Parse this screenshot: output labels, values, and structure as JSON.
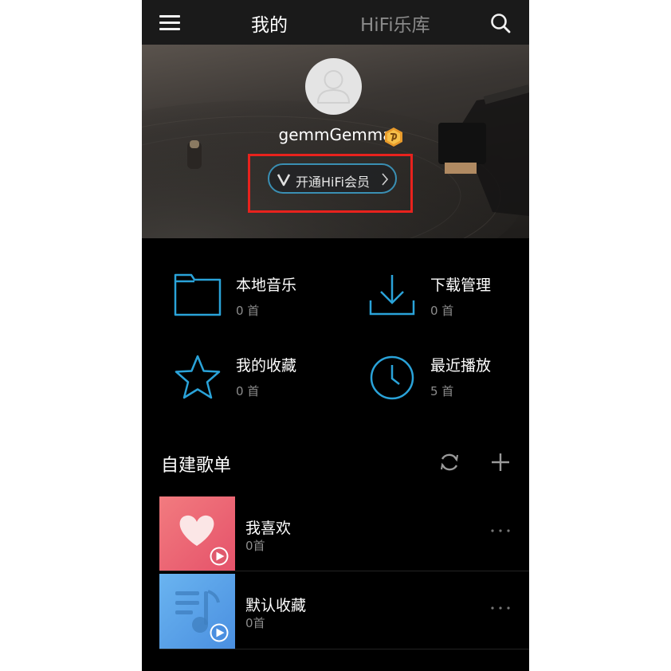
{
  "topbar": {
    "menu_icon": "menu-icon",
    "tab_mine": "我的",
    "tab_hifi": "HiFi乐库",
    "search_icon": "search-icon"
  },
  "profile": {
    "username": "gemmGemma",
    "vip_badge_icon": "vip-level-badge-icon",
    "vip_button_label": "开通HiFi会员",
    "highlight_color": "#e8221d"
  },
  "entries": [
    {
      "title": "本地音乐",
      "count": "0 首",
      "icon": "folder-icon"
    },
    {
      "title": "下载管理",
      "count": "0 首",
      "icon": "download-icon"
    },
    {
      "title": "我的收藏",
      "count": "0 首",
      "icon": "star-icon"
    },
    {
      "title": "最近播放",
      "count": "5 首",
      "icon": "clock-icon"
    }
  ],
  "playlists": {
    "section_title": "自建歌单",
    "refresh_icon": "refresh-icon",
    "add_icon": "plus-icon",
    "items": [
      {
        "title": "我喜欢",
        "count": "0首",
        "cover": "heart-cover"
      },
      {
        "title": "默认收藏",
        "count": "0首",
        "cover": "music-note-cover"
      }
    ]
  },
  "colors": {
    "accent": "#2aa3d9",
    "background": "#000000",
    "topbar": "#1a1a1a"
  }
}
